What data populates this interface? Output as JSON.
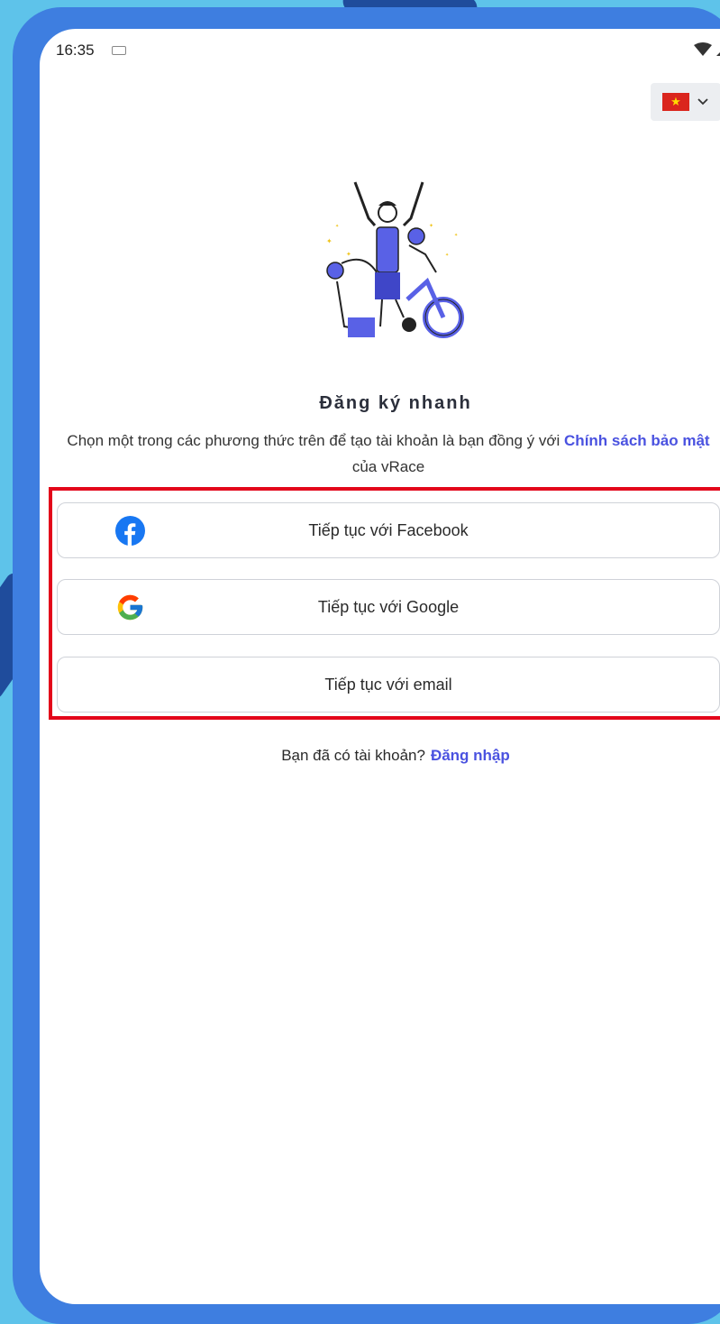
{
  "status_bar": {
    "time": "16:35"
  },
  "language": {
    "flag": "vietnam-flag",
    "star": "★"
  },
  "signup": {
    "title": "Đăng ký nhanh",
    "desc_prefix": "Chọn một trong các phương thức trên để tạo tài khoản là bạn đồng ý với ",
    "policy_link": "Chính sách bảo mật",
    "desc_suffix": " của vRace"
  },
  "buttons": {
    "facebook": "Tiếp tục với Facebook",
    "google": "Tiếp tục với Google",
    "email": "Tiếp tục với email"
  },
  "login": {
    "prompt": "Bạn đã có tài khoản?",
    "link": "Đăng nhập"
  },
  "colors": {
    "accent": "#4a52e0",
    "highlight": "#e3061a",
    "facebook": "#1877f2"
  }
}
